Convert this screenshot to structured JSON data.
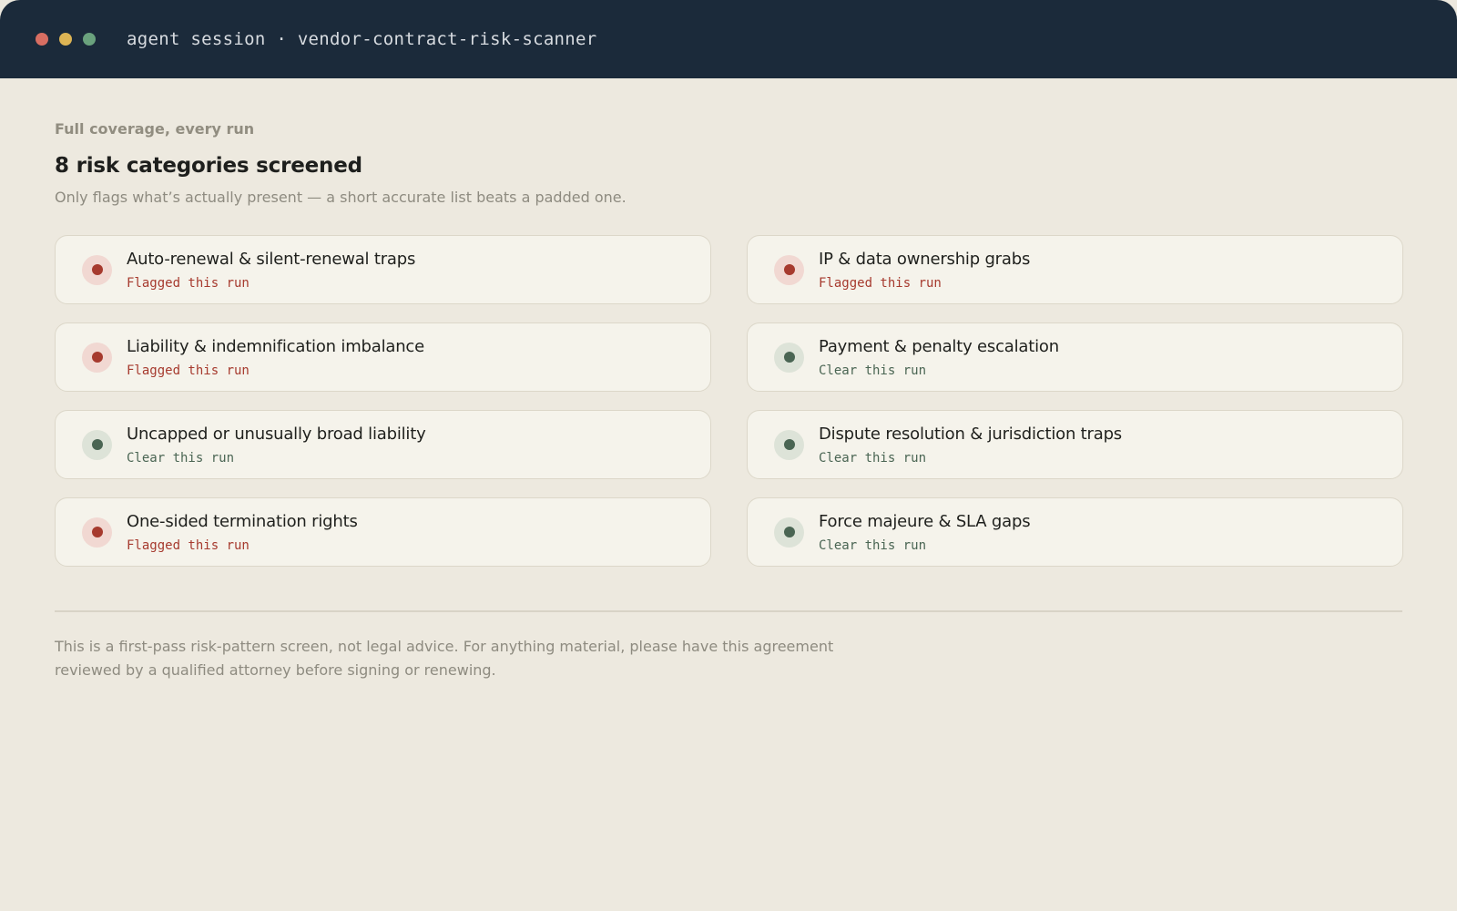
{
  "window": {
    "title": "agent session · vendor-contract-risk-scanner"
  },
  "header": {
    "eyebrow": "Full coverage, every run",
    "heading": "8 risk categories screened",
    "subtitle": "Only flags what’s actually present — a short accurate list beats a padded one."
  },
  "categories": [
    {
      "label": "Auto-renewal & silent-renewal traps",
      "status": "Flagged this run",
      "state": "flagged"
    },
    {
      "label": "IP & data ownership grabs",
      "status": "Flagged this run",
      "state": "flagged"
    },
    {
      "label": "Liability & indemnification imbalance",
      "status": "Flagged this run",
      "state": "flagged"
    },
    {
      "label": "Payment & penalty escalation",
      "status": "Clear this run",
      "state": "clear"
    },
    {
      "label": "Uncapped or unusually broad liability",
      "status": "Clear this run",
      "state": "clear"
    },
    {
      "label": "Dispute resolution & jurisdiction traps",
      "status": "Clear this run",
      "state": "clear"
    },
    {
      "label": "One-sided termination rights",
      "status": "Flagged this run",
      "state": "flagged"
    },
    {
      "label": "Force majeure & SLA gaps",
      "status": "Clear this run",
      "state": "clear"
    }
  ],
  "footer": {
    "disclaimer": "This is a first-pass risk-pattern screen, not legal advice. For anything material, please have this agreement reviewed by a qualified attorney before signing or renewing."
  },
  "colors": {
    "titlebar_bg": "#1b2a3a",
    "flagged": "#a63a2e",
    "clear": "#4a6553"
  }
}
